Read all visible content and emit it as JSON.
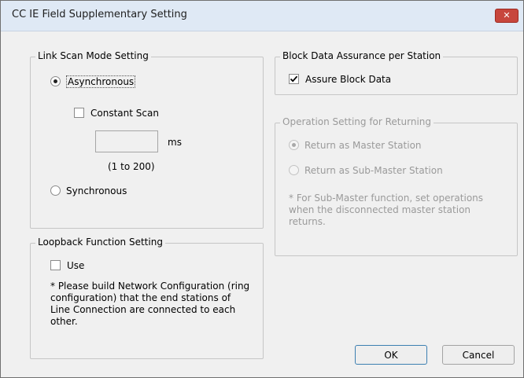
{
  "window": {
    "title": "CC IE Field Supplementary Setting",
    "close_label": "✕"
  },
  "link_scan": {
    "legend": "Link Scan Mode Setting",
    "asynchronous_label": "Asynchronous",
    "asynchronous_selected": true,
    "constant_scan_label": "Constant Scan",
    "constant_scan_checked": false,
    "constant_scan_value": "",
    "unit": "ms",
    "range": "(1 to 200)",
    "synchronous_label": "Synchronous",
    "synchronous_selected": false
  },
  "loopback": {
    "legend": "Loopback Function Setting",
    "use_label": "Use",
    "use_checked": false,
    "note_line1": "* Please build Network Configuration (ring",
    "note_line2": "configuration) that the end stations of",
    "note_line3": "Line Connection are connected to each",
    "note_line4": "other."
  },
  "block_data": {
    "legend": "Block Data Assurance per Station",
    "assure_label": "Assure Block Data",
    "assure_checked": true
  },
  "returning": {
    "legend": "Operation Setting for Returning",
    "master_label": "Return as Master Station",
    "master_selected": true,
    "submaster_label": "Return as Sub-Master Station",
    "submaster_selected": false,
    "note_line1": "* For Sub-Master function, set operations",
    "note_line2": "when the disconnected master station",
    "note_line3": "returns."
  },
  "buttons": {
    "ok_label": "OK",
    "cancel_label": "Cancel"
  }
}
